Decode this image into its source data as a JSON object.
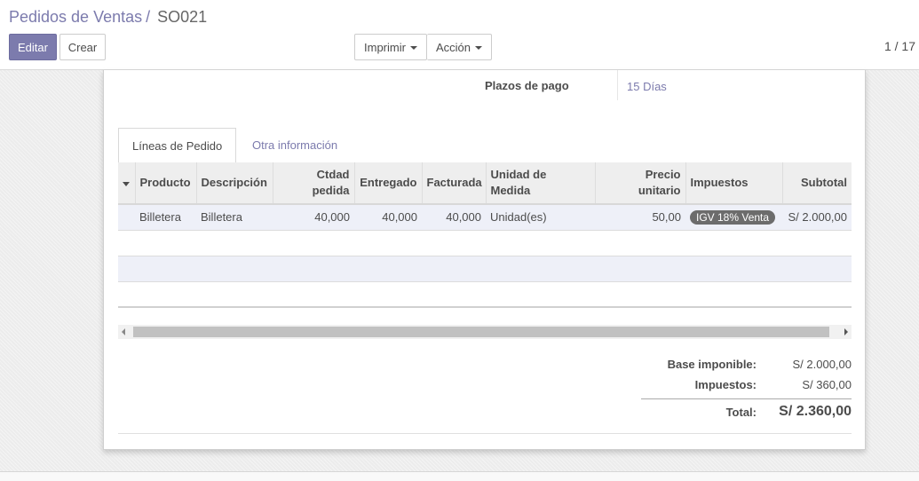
{
  "breadcrumb": {
    "parent": "Pedidos de Ventas",
    "separator": "/",
    "current": "SO021"
  },
  "toolbar": {
    "edit_label": "Editar",
    "create_label": "Crear",
    "print_label": "Imprimir",
    "action_label": "Acción"
  },
  "pager": {
    "text": "1 / 17"
  },
  "form": {
    "payment_terms_label": "Plazos de pago",
    "payment_terms_value": "15 Días"
  },
  "tabs": [
    {
      "label": "Líneas de Pedido"
    },
    {
      "label": "Otra información"
    }
  ],
  "table": {
    "headers": {
      "product": "Producto",
      "description": "Descripción",
      "qty_line1": "Ctdad",
      "qty_line2": "pedida",
      "delivered": "Entregado",
      "invoiced": "Facturada",
      "uom_line1": "Unidad de",
      "uom_line2": "Medida",
      "price_line1": "Precio",
      "price_line2": "unitario",
      "taxes": "Impuestos",
      "subtotal": "Subtotal"
    },
    "rows": [
      {
        "product": "Billetera",
        "description": "Billetera",
        "qty": "40,000",
        "delivered": "40,000",
        "invoiced": "40,000",
        "uom": "Unidad(es)",
        "price": "50,00",
        "tax": "IGV 18% Venta",
        "subtotal": "S/ 2.000,00"
      }
    ]
  },
  "totals": {
    "base_label": "Base imponible:",
    "base_value": "S/ 2.000,00",
    "tax_label": "Impuestos:",
    "tax_value": "S/ 360,00",
    "total_label": "Total:",
    "total_value": "S/ 2.360,00"
  },
  "colors": {
    "brand": "#7c7bad",
    "tax_badge": "#6c6c6c",
    "row_highlight": "#eef0f8"
  }
}
